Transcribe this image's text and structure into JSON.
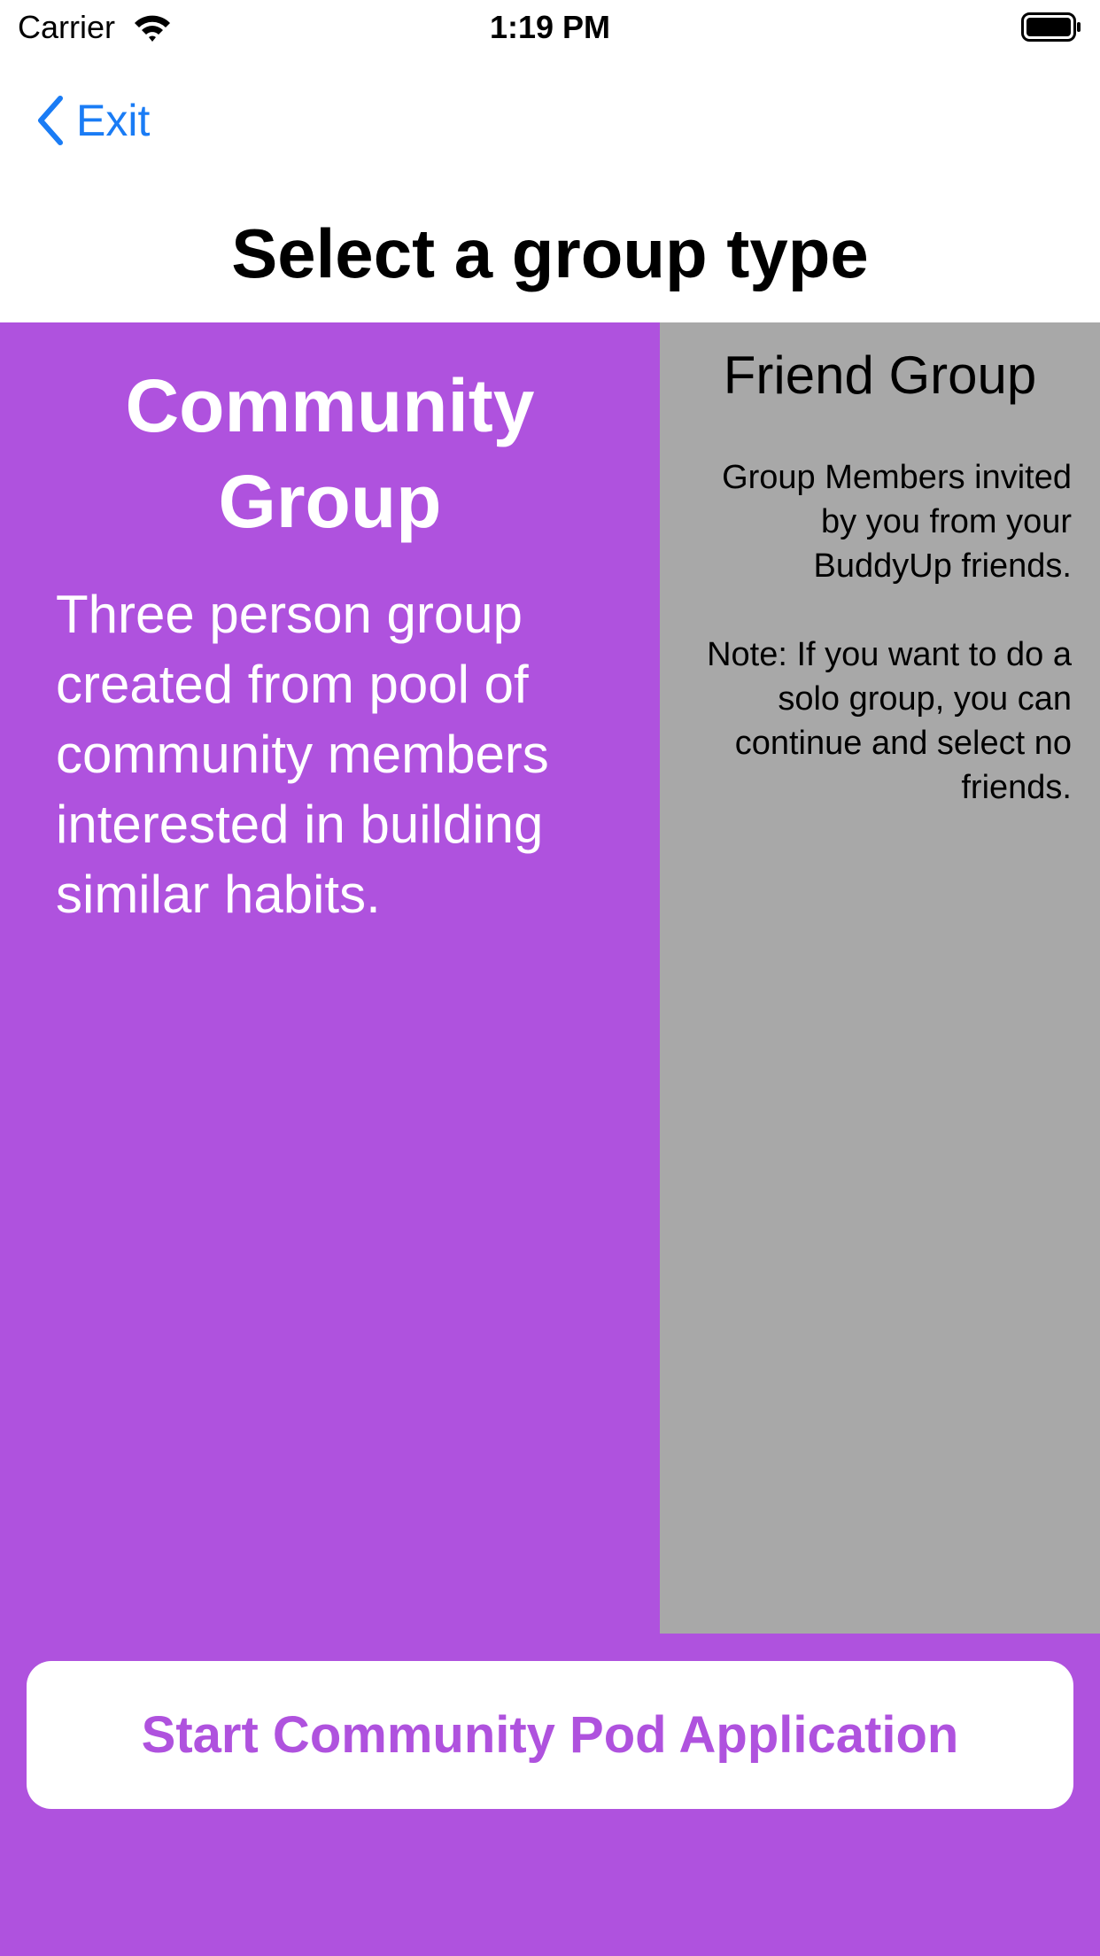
{
  "status_bar": {
    "carrier": "Carrier",
    "time": "1:19 PM",
    "icons": [
      "wifi-icon",
      "battery-icon"
    ]
  },
  "nav": {
    "back_label": "Exit",
    "back_icon": "chevron-left-icon",
    "title": "Select a group type"
  },
  "community": {
    "title_line1": "Community",
    "title_line2": "Group",
    "description": "Three person group created from pool of community members interested in building similar habits."
  },
  "friend": {
    "title": "Friend Group",
    "description": "Group Members invited by you from your BuddyUp friends.",
    "note": "Note: If you want to do a solo group, you can continue and select no friends."
  },
  "action": {
    "start_label": "Start Community Pod Application"
  },
  "colors": {
    "accent": "#af52de",
    "link": "#1a7cf5",
    "friend_panel": "#a8a8a8"
  }
}
